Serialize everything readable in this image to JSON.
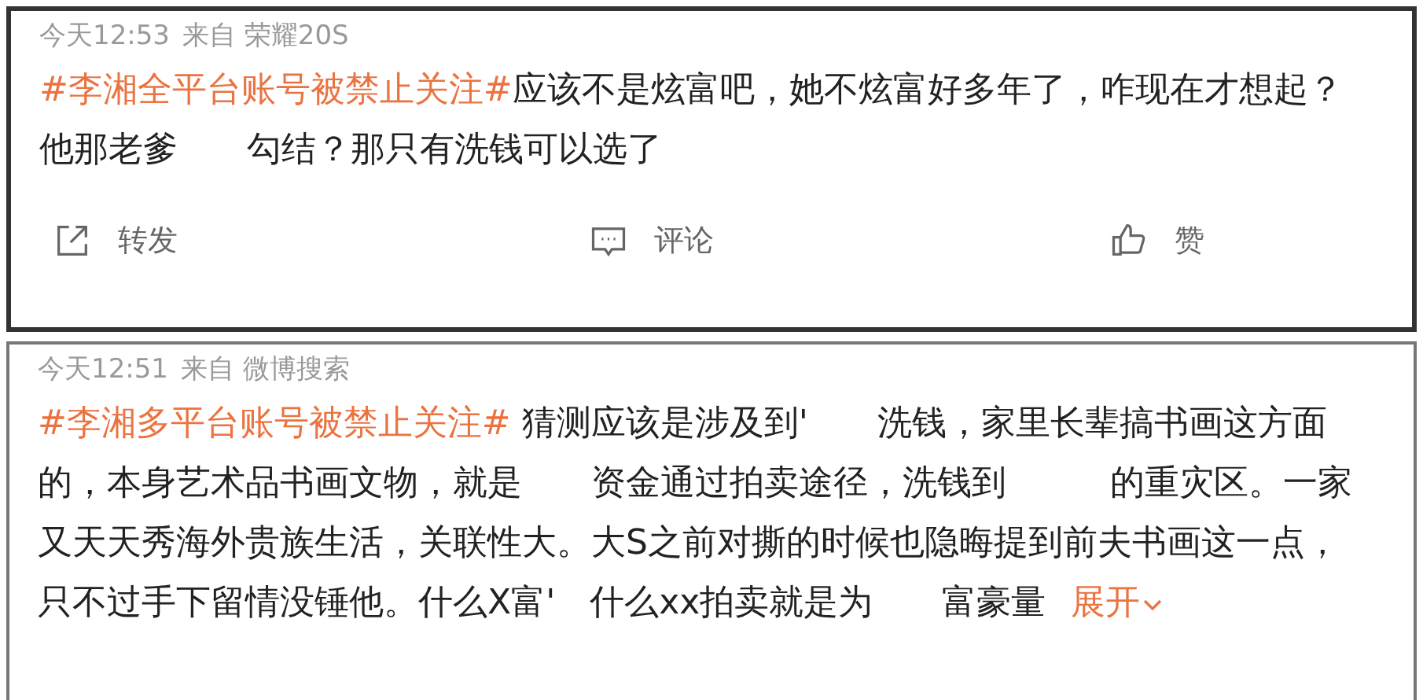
{
  "posts": [
    {
      "time": "今天12:53",
      "source": "来自 荣耀20S",
      "topic": "#李湘全平台账号被禁止关注#",
      "body": "应该不是炫富吧，她不炫富好多年了，咋现在才想起？他那老爹　　勾结？那只有洗钱可以选了",
      "actions": [
        {
          "kind": "share",
          "label": "转发"
        },
        {
          "kind": "comment",
          "label": "评论"
        },
        {
          "kind": "like",
          "label": "赞"
        }
      ]
    },
    {
      "time": "今天12:51",
      "source": "来自 微博搜索",
      "topic": "#李湘多平台账号被禁止关注#",
      "body": " 猜测应该是涉及到'　　洗钱，家里长辈搞书画这方面的，本身艺术品书画文物，就是　　资金通过拍卖途径，洗钱到　　　的重灾区。一家又天天秀海外贵族生活，关联性大。大S之前对撕的时候也隐晦提到前夫书画这一点，只不过手下留情没锤他。什么X富'　什么xx拍卖就是为　　富豪量",
      "expand": "展开"
    }
  ]
}
